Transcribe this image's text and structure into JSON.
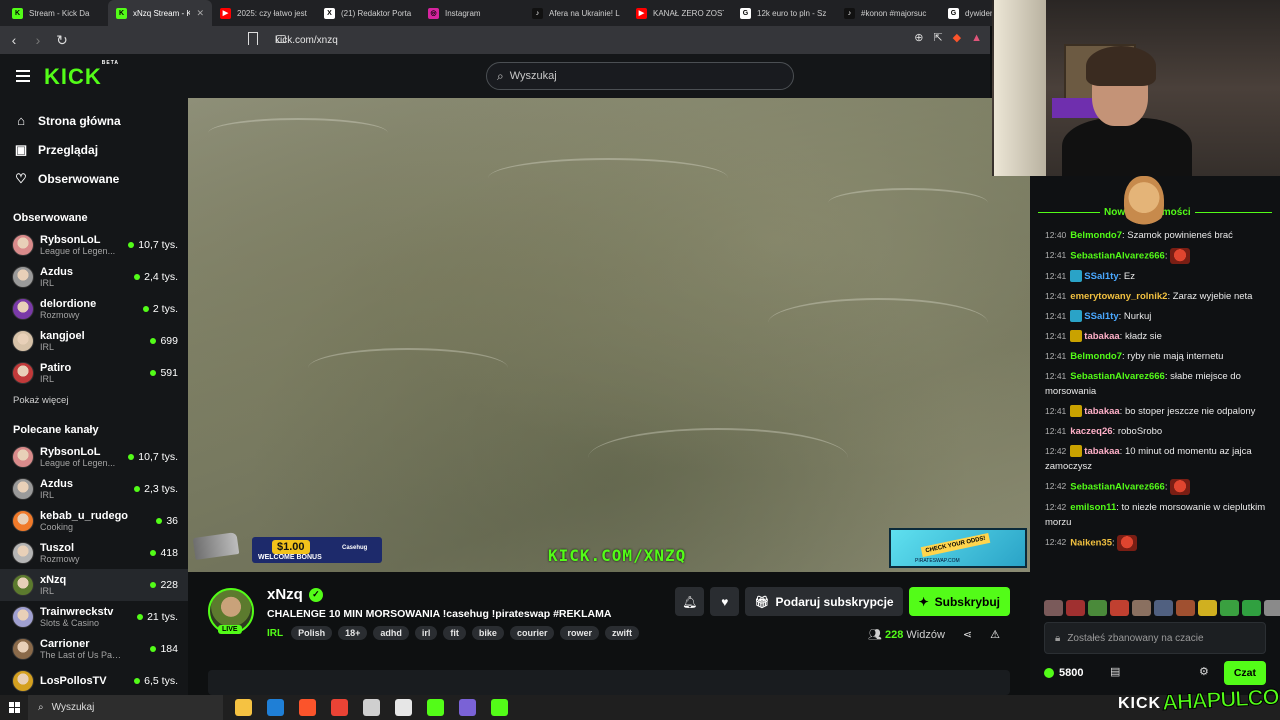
{
  "browser": {
    "tabs": [
      {
        "title": "Stream - Kick Da",
        "fav_color": "#53fc18",
        "fav_letter": "K",
        "active": false
      },
      {
        "title": "xNzq Stream - K",
        "fav_color": "#53fc18",
        "fav_letter": "K",
        "active": true
      },
      {
        "title": "2025: czy łatwo jest",
        "fav_color": "#ff0000",
        "fav_letter": "▶",
        "active": false
      },
      {
        "title": "(21) Redaktor Porta",
        "fav_color": "#ffffff",
        "fav_letter": "X",
        "active": false
      },
      {
        "title": "Instagram",
        "fav_color": "#d6249f",
        "fav_letter": "◎",
        "active": false
      },
      {
        "title": "Afera na Ukrainie! L",
        "fav_color": "#111111",
        "fav_letter": "♪",
        "active": false
      },
      {
        "title": "KANAŁ ZERO ZOSTA",
        "fav_color": "#ff0000",
        "fav_letter": "▶",
        "active": false
      },
      {
        "title": "12k euro to pln - Sz",
        "fav_color": "#ffffff",
        "fav_letter": "G",
        "active": false
      },
      {
        "title": "#konon #majorsuc",
        "fav_color": "#111111",
        "fav_letter": "♪",
        "active": false
      },
      {
        "title": "dywidend",
        "fav_color": "#ffffff",
        "fav_letter": "G",
        "active": false
      }
    ],
    "url": "kick.com/xnzq"
  },
  "header": {
    "logo": "KICK",
    "logo_beta": "BETA",
    "search_placeholder": "Wyszukaj"
  },
  "sidebar": {
    "nav": [
      {
        "label": "Strona główna",
        "icon": "home-icon",
        "glyph": "⌂"
      },
      {
        "label": "Przeglądaj",
        "icon": "browse-icon",
        "glyph": "▣"
      },
      {
        "label": "Obserwowane",
        "icon": "heart-icon",
        "glyph": "♡"
      }
    ],
    "followed_label": "Obserwowane",
    "followed": [
      {
        "name": "RybsonLoL",
        "category": "League of Legen...",
        "viewers": "10,7 tys.",
        "color": "#d98b8b"
      },
      {
        "name": "Azdus",
        "category": "IRL",
        "viewers": "2,4 tys.",
        "color": "#9a9a9a"
      },
      {
        "name": "delordione",
        "category": "Rozmowy",
        "viewers": "2 tys.",
        "color": "#7a3aa8"
      },
      {
        "name": "kangjoel",
        "category": "IRL",
        "viewers": "699",
        "color": "#d7c2a8"
      },
      {
        "name": "Patiro",
        "category": "IRL",
        "viewers": "591",
        "color": "#c23a3a"
      }
    ],
    "show_more": "Pokaż więcej",
    "recommended_label": "Polecane kanały",
    "recommended": [
      {
        "name": "RybsonLoL",
        "category": "League of Legen...",
        "viewers": "10,7 tys.",
        "color": "#d98b8b",
        "selected": false
      },
      {
        "name": "Azdus",
        "category": "IRL",
        "viewers": "2,3 tys.",
        "color": "#9a9a9a",
        "selected": false
      },
      {
        "name": "kebab_u_rudego",
        "category": "Cooking",
        "viewers": "36",
        "color": "#f07a2a",
        "selected": false
      },
      {
        "name": "Tuszol",
        "category": "Rozmowy",
        "viewers": "418",
        "color": "#b5b5b5",
        "selected": false
      },
      {
        "name": "xNzq",
        "category": "IRL",
        "viewers": "228",
        "color": "#5c7a2e",
        "selected": true
      },
      {
        "name": "Trainwreckstv",
        "category": "Slots & Casino",
        "viewers": "21 tys.",
        "color": "#a0a0d0",
        "selected": false
      },
      {
        "name": "Carrioner",
        "category": "The Last of Us Part II",
        "viewers": "184",
        "color": "#8a6a4a",
        "selected": false
      },
      {
        "name": "LosPollosTV",
        "category": "",
        "viewers": "6,5 tys.",
        "color": "#d4a020",
        "selected": false
      }
    ]
  },
  "video": {
    "promo_amount": "$1.00",
    "promo_bonus": "WELCOME BONUS",
    "promo_brand": "Casehug",
    "watermark": "KICK.COM/XNZQ",
    "right_promo_label": "CHECK YOUR ODDS!",
    "right_promo_site": "PIRATESWAP.COM"
  },
  "stream": {
    "streamer": "xNzq",
    "live_label": "LIVE",
    "title": "CHALENGE 10 MIN MORSOWANIA !casehug !pirateswap #REKLAMA",
    "category": "IRL",
    "tags": [
      "Polish",
      "18+",
      "adhd",
      "irl",
      "fit",
      "bike",
      "courier",
      "rower",
      "zwift"
    ],
    "gift_label": "Podaruj subskrypcje",
    "subscribe_label": "Subskrybuj",
    "viewers_count": "228",
    "viewers_label": "Widzów"
  },
  "chat": {
    "new_messages_label": "Nowe wiadomości",
    "messages": [
      {
        "time": "12:40",
        "user": "Belmondo7",
        "color": "#53fc18",
        "text": "Szamok powinieneś brać",
        "emote": false,
        "badge": null
      },
      {
        "time": "12:41",
        "user": "SebastianAlvarez666",
        "color": "#53fc18",
        "text": "",
        "emote": true,
        "badge": null
      },
      {
        "time": "12:41",
        "user": "SSal1ty",
        "color": "#4aa8ff",
        "text": "Ez",
        "emote": false,
        "badge": "#2aa3c7"
      },
      {
        "time": "12:41",
        "user": "emerytowany_rolnik2",
        "color": "#f0c040",
        "text": "Zaraz wyjebie neta",
        "emote": false,
        "badge": null
      },
      {
        "time": "12:41",
        "user": "SSal1ty",
        "color": "#4aa8ff",
        "text": "Nurkuj",
        "emote": false,
        "badge": "#2aa3c7"
      },
      {
        "time": "12:41",
        "user": "tabakaa",
        "color": "#ffb0c8",
        "text": "kładz sie",
        "emote": false,
        "badge": "#c9a200"
      },
      {
        "time": "12:41",
        "user": "Belmondo7",
        "color": "#53fc18",
        "text": "ryby nie mają internetu",
        "emote": false,
        "badge": null
      },
      {
        "time": "12:41",
        "user": "SebastianAlvarez666",
        "color": "#53fc18",
        "text": "słabe miejsce do morsowania",
        "emote": false,
        "badge": null
      },
      {
        "time": "12:41",
        "user": "tabakaa",
        "color": "#ffb0c8",
        "text": "bo stoper jeszcze nie odpalony",
        "emote": false,
        "badge": "#c9a200"
      },
      {
        "time": "12:41",
        "user": "kaczeq26",
        "color": "#ffb0c8",
        "text": "roboSrobo",
        "emote": false,
        "badge": null
      },
      {
        "time": "12:42",
        "user": "tabakaa",
        "color": "#ffb0c8",
        "text": "10 minut od momentu az jajca zamoczysz",
        "emote": false,
        "badge": "#c9a200"
      },
      {
        "time": "12:42",
        "user": "SebastianAlvarez666",
        "color": "#53fc18",
        "text": "",
        "emote": true,
        "badge": null
      },
      {
        "time": "12:42",
        "user": "emilson11",
        "color": "#53fc18",
        "text": "to niezłe morsowanie w cieplutkim morzu",
        "emote": false,
        "badge": null
      },
      {
        "time": "12:42",
        "user": "Naiken35",
        "color": "#f0c040",
        "text": "",
        "emote": true,
        "badge": null
      }
    ],
    "emote_colors": [
      "#7a5a5a",
      "#a03030",
      "#4a8a3a",
      "#c04030",
      "#8a7060",
      "#506080",
      "#a05030",
      "#d0b020",
      "#3aa040",
      "#30a040",
      "#8a8a8a"
    ],
    "input_placeholder": "Zostałeś zbanowany na czacie",
    "points": "5800",
    "chat_button": "Czat"
  },
  "taskbar": {
    "search_placeholder": "Wyszukaj",
    "apps": [
      "#f5c242",
      "#1f7fd6",
      "#fb542b",
      "#ea4335",
      "#cfcfcf",
      "#e6e6e6",
      "#53fc18",
      "#7a62d6",
      "#53fc18"
    ],
    "brand_kick": "KICK",
    "brand_overlay": "AHAPULCO"
  }
}
